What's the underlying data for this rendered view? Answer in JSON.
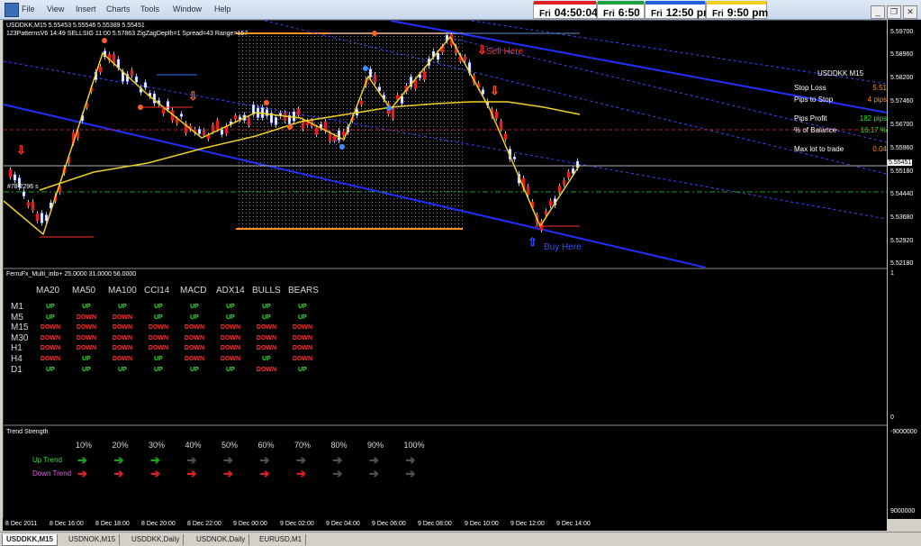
{
  "menu": [
    "File",
    "View",
    "Insert",
    "Charts",
    "Tools",
    "Window",
    "Help"
  ],
  "clocks": [
    {
      "day": "Fri",
      "time": "04:50:04",
      "color": "#e02020"
    },
    {
      "day": "Fri",
      "time": "6:50",
      "color": "#20a040"
    },
    {
      "day": "Fri",
      "time": "12:50 pm",
      "color": "#2060e0"
    },
    {
      "day": "Fri",
      "time": "9:50 pm",
      "color": "#f0d020"
    }
  ],
  "chart": {
    "header1": "USDDKK,M15  5.55453 5.55546 5.55389 5.55451",
    "header2": "123PatternsV6  14:49  SELLSIG  11:00  5.57863  ZigZagDepth=1  Spread=43  Range=157",
    "sell_label": "Sell Here",
    "buy_label": "Buy Here",
    "left_label": "#78 2296 s"
  },
  "price_axis": [
    "5.59700",
    "5.58960",
    "5.58200",
    "5.57460",
    "5.56700",
    "5.55960",
    "5.55180",
    "5.54440",
    "5.53680",
    "5.52920",
    "5.52180"
  ],
  "current_price": "5.55451",
  "info": {
    "title": "USDDKK  M15",
    "rows": [
      {
        "label": "Stop Loss",
        "value": "5.51",
        "color": "#ff9020"
      },
      {
        "label": "Pips to Stop",
        "value": "4 pips",
        "color": "#ff9020"
      },
      {
        "label": "Pips Profit",
        "value": "182 pips",
        "color": "#30e030"
      },
      {
        "label": "% of Balance",
        "value": "16.17 %",
        "color": "#30e030"
      },
      {
        "label": "Max lot to trade",
        "value": "0.04",
        "color": "#ff9020"
      }
    ]
  },
  "indicator": {
    "title": "FerruFx_Multi_info+ 25.0000 31.0000 56.0000",
    "headers": [
      "MA20",
      "MA50",
      "MA100",
      "CCI14",
      "MACD",
      "ADX14",
      "BULLS",
      "BEARS"
    ],
    "rows": [
      {
        "tf": "M1",
        "vals": [
          "UP",
          "UP",
          "UP",
          "UP",
          "UP",
          "UP",
          "UP",
          "UP"
        ]
      },
      {
        "tf": "M5",
        "vals": [
          "UP",
          "DOWN",
          "DOWN",
          "UP",
          "UP",
          "UP",
          "UP",
          "UP"
        ]
      },
      {
        "tf": "M15",
        "vals": [
          "DOWN",
          "DOWN",
          "DOWN",
          "DOWN",
          "DOWN",
          "DOWN",
          "DOWN",
          "DOWN"
        ]
      },
      {
        "tf": "M30",
        "vals": [
          "DOWN",
          "DOWN",
          "DOWN",
          "DOWN",
          "DOWN",
          "DOWN",
          "DOWN",
          "DOWN"
        ]
      },
      {
        "tf": "H1",
        "vals": [
          "DOWN",
          "DOWN",
          "DOWN",
          "DOWN",
          "DOWN",
          "DOWN",
          "DOWN",
          "DOWN"
        ]
      },
      {
        "tf": "H4",
        "vals": [
          "DOWN",
          "UP",
          "DOWN",
          "UP",
          "DOWN",
          "DOWN",
          "UP",
          "DOWN"
        ]
      },
      {
        "tf": "D1",
        "vals": [
          "UP",
          "UP",
          "UP",
          "UP",
          "UP",
          "UP",
          "DOWN",
          "UP"
        ]
      }
    ],
    "axis": [
      "1",
      "0"
    ]
  },
  "trend": {
    "title": "Trend Strength",
    "percents": [
      "10%",
      "20%",
      "30%",
      "40%",
      "50%",
      "60%",
      "70%",
      "80%",
      "90%",
      "100%"
    ],
    "up_label": "Up Trend",
    "down_label": "Down Trend",
    "up_colors": [
      "#20a020",
      "#20a020",
      "#20a020",
      "#505050",
      "#505050",
      "#505050",
      "#505050",
      "#505050",
      "#505050",
      "#505050"
    ],
    "down_colors": [
      "#e02020",
      "#e02020",
      "#e02020",
      "#e02020",
      "#e02020",
      "#e02020",
      "#e02020",
      "#505050",
      "#505050",
      "#505050"
    ],
    "axis": [
      "-9000000",
      "9000000"
    ]
  },
  "time_axis": [
    "8 Dec 2011",
    "8 Dec 16:00",
    "8 Dec 18:00",
    "8 Dec 20:00",
    "8 Dec 22:00",
    "9 Dec 00:00",
    "9 Dec 02:00",
    "9 Dec 04:00",
    "9 Dec 06:00",
    "9 Dec 08:00",
    "9 Dec 10:00",
    "9 Dec 12:00",
    "9 Dec 14:00"
  ],
  "tabs": [
    "USDDKK,M15",
    "USDNOK,M15",
    "USDDKK,Daily",
    "USDNOK,Daily",
    "EURUSD,M1"
  ],
  "colors": {
    "up": "#30e030",
    "down": "#ff3030",
    "zigzag": "#f0d020",
    "channel": "#2030ff",
    "orange": "#ff9020"
  }
}
